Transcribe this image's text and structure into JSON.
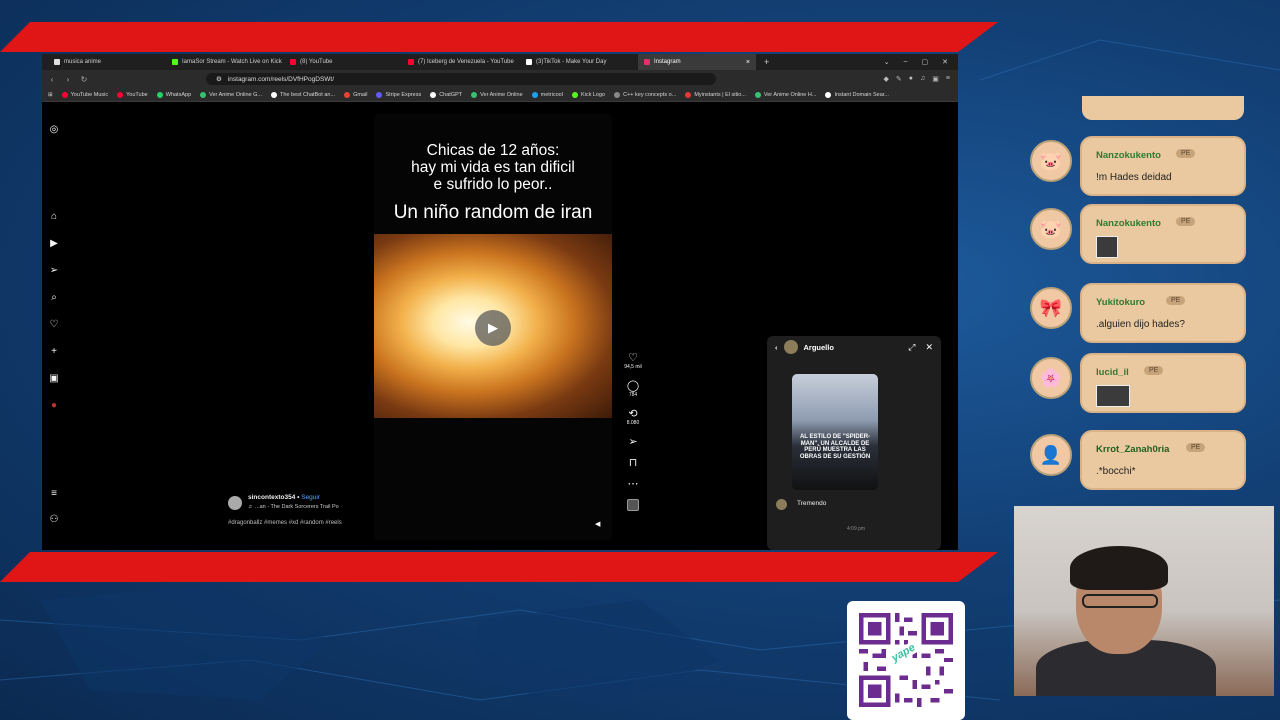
{
  "browser": {
    "tabs": [
      {
        "label": "musica anime",
        "fav_color": "#e0e0e0",
        "active": false
      },
      {
        "label": "IamaSor Stream - Watch Live on Kick",
        "fav_color": "#53fc18",
        "active": false
      },
      {
        "label": "(8) YouTube",
        "fav_color": "#ff0033",
        "active": false
      },
      {
        "label": "(7) Iceberg de Venezuela - YouTube",
        "fav_color": "#ff0033",
        "active": false
      },
      {
        "label": "(3)TikTok - Make Your Day",
        "fav_color": "#ffffff",
        "active": false
      },
      {
        "label": "Instagram",
        "fav_color": "#e1306c",
        "active": true
      }
    ],
    "new_tab_symbol": "+",
    "tab_close_symbol": "×",
    "window_controls": [
      "⌄",
      "–",
      "▢",
      "✕"
    ],
    "url": "instagram.com/reels/DVfHPogDSWt/",
    "bookmarks": [
      {
        "label": "YouTube Music",
        "color": "#ff0033"
      },
      {
        "label": "YouTube",
        "color": "#ff0033"
      },
      {
        "label": "WhatsApp",
        "color": "#25d366"
      },
      {
        "label": "Ver Anime Online G...",
        "color": "#38c172"
      },
      {
        "label": "The best ChatBot an...",
        "color": "#ffffff"
      },
      {
        "label": "Gmail",
        "color": "#ea4335"
      },
      {
        "label": "Stripe Express",
        "color": "#635bff"
      },
      {
        "label": "ChatGPT",
        "color": "#ffffff"
      },
      {
        "label": "Ver Anime Online",
        "color": "#38c172"
      },
      {
        "label": "metricool",
        "color": "#1da1f2"
      },
      {
        "label": "Kick Logo",
        "color": "#53fc18"
      },
      {
        "label": "C++ key concepts o...",
        "color": "#888888"
      },
      {
        "label": "Myinstants | El sitio...",
        "color": "#e53935"
      },
      {
        "label": "Ver Anime Online H...",
        "color": "#38c172"
      },
      {
        "label": "Instant Domain Sear...",
        "color": "#ffffff"
      }
    ]
  },
  "reel": {
    "top_lines": [
      "Chicas de 12 años:",
      "hay mi vida es tan dificil",
      "e sufrido lo peor.."
    ],
    "bottom_line": "Un niño random de iran",
    "play_symbol": "▶",
    "author": "sincontexto354",
    "separator": "•",
    "follow_label": "Seguir",
    "audio": "♬ ...an - The Dark Sorcerers Trail  Po",
    "hashtags": "#dragonballz #memes #xd #random #reels",
    "mute_symbol": "◀",
    "actions": [
      {
        "name": "like",
        "icon": "♡",
        "count": "94,5 mil"
      },
      {
        "name": "comment",
        "icon": "◯",
        "count": "784"
      },
      {
        "name": "repost",
        "icon": "⟲",
        "count": "8.080"
      },
      {
        "name": "share",
        "icon": "➢",
        "count": ""
      },
      {
        "name": "save",
        "icon": "⊓",
        "count": ""
      },
      {
        "name": "more",
        "icon": "⋯",
        "count": ""
      }
    ]
  },
  "dm": {
    "contact": "Arguello",
    "shared_caption": "AL ESTILO DE \"SPIDER-MAN\", UN ALCALDE DE PERÚ MUESTRA LAS OBRAS DE SU GESTIÓN",
    "message": "Tremendo",
    "time": "4:09 pm",
    "placeholder": "Enviar mensaje..."
  },
  "chat": {
    "messages": [
      {
        "user": "Nanzokukento",
        "badge": "PE",
        "text": "!m Hades deidad",
        "has_image": false,
        "avatar": "🐷"
      },
      {
        "user": "Nanzokukento",
        "badge": "PE",
        "text": "",
        "has_image": true,
        "avatar": "🐷"
      },
      {
        "user": "Yukitokuro",
        "badge": "PE",
        "text": ".alguien dijo hades?",
        "has_image": false,
        "avatar": "🎀"
      },
      {
        "user": "lucid_il",
        "badge": "PE",
        "text": "",
        "has_image": true,
        "avatar": "🌸"
      },
      {
        "user": "Krrot_Zanah0ria",
        "badge": "PE",
        "text": ".*bocchi*",
        "has_image": false,
        "avatar": "👤"
      }
    ]
  },
  "qr": {
    "label": "yape"
  }
}
